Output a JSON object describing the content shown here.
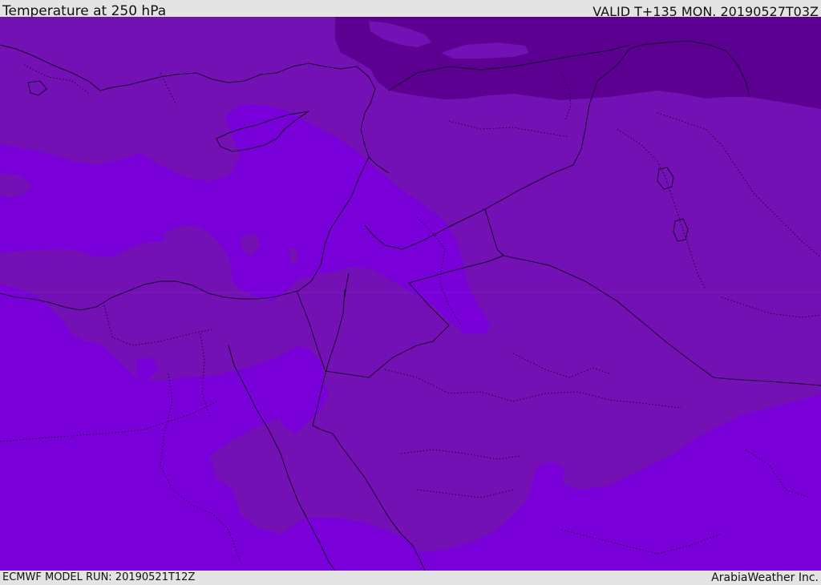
{
  "header": {
    "title": "Temperature at 250 hPa",
    "valid": "VALID T+135 MON. 20190527T03Z"
  },
  "footer": {
    "model_run": "ECMWF MODEL RUN: 20190521T12Z",
    "credit": "ArabiaWeather Inc."
  },
  "map": {
    "field": "temperature-250hPa",
    "colors": {
      "band_cold": "#5c0092",
      "band_mid": "#7311b4",
      "band_warm": "#7a00d9",
      "border": "#1a0030"
    }
  }
}
